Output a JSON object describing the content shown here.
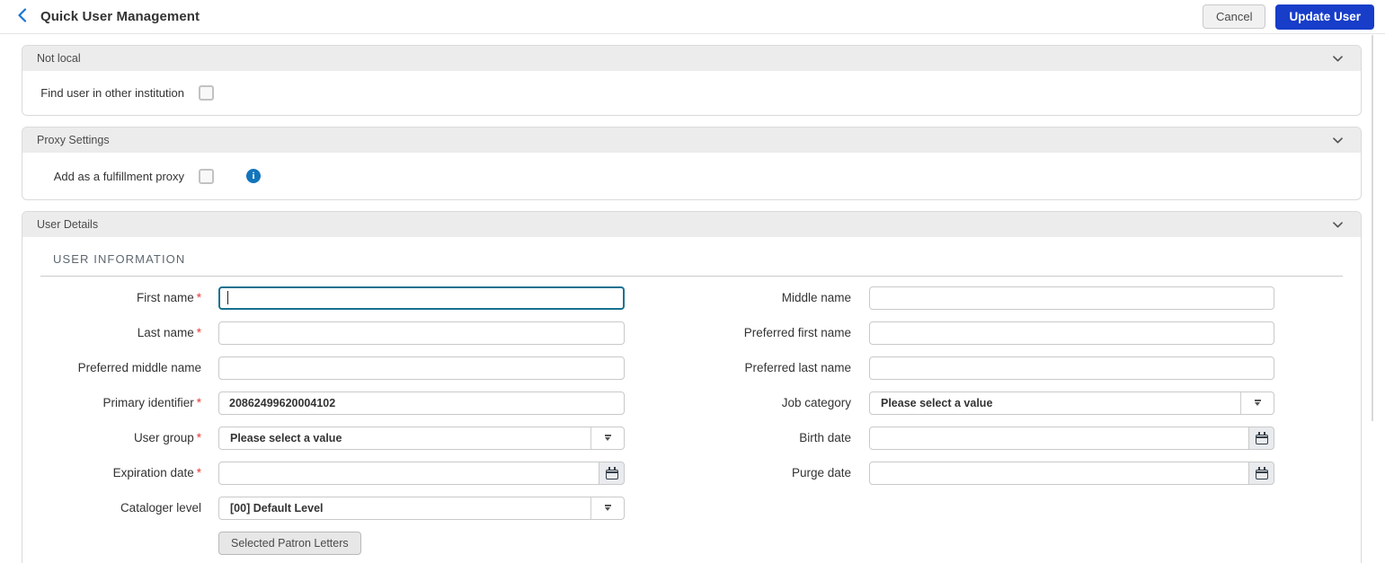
{
  "header": {
    "title": "Quick User Management",
    "buttons": {
      "cancel": "Cancel",
      "update": "Update User"
    }
  },
  "colors": {
    "primary_button": "#173dc9",
    "focus_border": "#17728f",
    "back_chevron": "#1976d2",
    "info_icon": "#1274bb",
    "required_marker": "#e53935",
    "section_header_bg": "#ececec"
  },
  "sections": {
    "not_local": {
      "title": "Not local",
      "checkbox_label": "Find user in other institution",
      "checked": false
    },
    "proxy_settings": {
      "title": "Proxy Settings",
      "checkbox_label": "Add as a fulfillment proxy",
      "checked": false
    },
    "user_details": {
      "title": "User Details",
      "subsection_title": "USER INFORMATION",
      "required_marker": "*",
      "fields": {
        "first_name": {
          "label": "First name",
          "value": "",
          "required": true,
          "focused": true
        },
        "last_name": {
          "label": "Last name",
          "value": "",
          "required": true
        },
        "preferred_middle_name": {
          "label": "Preferred middle name",
          "value": ""
        },
        "primary_identifier": {
          "label": "Primary identifier",
          "value": "20862499620004102",
          "required": true
        },
        "user_group": {
          "label": "User group",
          "value": "Please select a value",
          "required": true
        },
        "expiration_date": {
          "label": "Expiration date",
          "value": "",
          "required": true
        },
        "cataloger_level": {
          "label": "Cataloger level",
          "value": "[00] Default Level"
        },
        "middle_name": {
          "label": "Middle name",
          "value": ""
        },
        "preferred_first_name": {
          "label": "Preferred first name",
          "value": ""
        },
        "preferred_last_name": {
          "label": "Preferred last name",
          "value": ""
        },
        "job_category": {
          "label": "Job category",
          "value": "Please select a value"
        },
        "birth_date": {
          "label": "Birth date",
          "value": ""
        },
        "purge_date": {
          "label": "Purge date",
          "value": ""
        }
      },
      "buttons": {
        "selected_patron_letters": "Selected Patron Letters"
      }
    }
  }
}
